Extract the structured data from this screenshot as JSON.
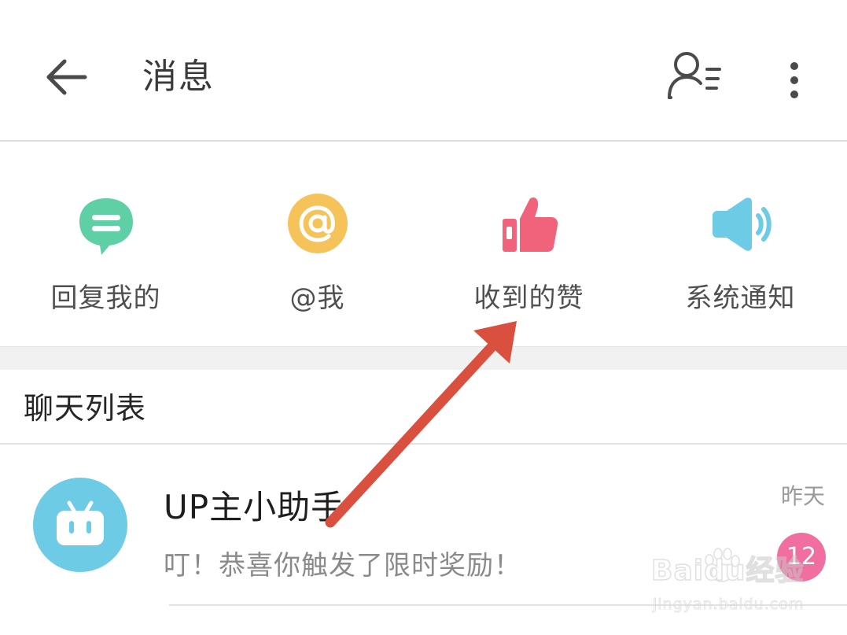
{
  "header": {
    "title": "消息",
    "back_icon": "arrow-left-icon",
    "contacts_icon": "contacts-icon",
    "more_icon": "more-vertical-icon"
  },
  "quick_entries": [
    {
      "label": "回复我的",
      "icon": "reply-chat-icon",
      "color": "#5fd0a6"
    },
    {
      "label": "@我",
      "icon": "at-icon",
      "color": "#f5c35a"
    },
    {
      "label": "收到的赞",
      "icon": "thumbs-up-icon",
      "color": "#f0637b"
    },
    {
      "label": "系统通知",
      "icon": "speaker-icon",
      "color": "#6dcbe6"
    }
  ],
  "chat_list": {
    "title": "聊天列表",
    "items": [
      {
        "name": "UP主小助手",
        "preview": "叮！恭喜你触发了限时奖励！",
        "time": "昨天",
        "unread": "12",
        "avatar_icon": "tv-robot-icon",
        "avatar_color": "#6dcbe6"
      }
    ]
  },
  "watermark": {
    "main": "Baidu经验",
    "sub": "jingyan.baidu.com"
  },
  "colors": {
    "annotation_arrow": "#d9503f",
    "badge": "#f06ea0",
    "divider": "#e2e2e2"
  }
}
